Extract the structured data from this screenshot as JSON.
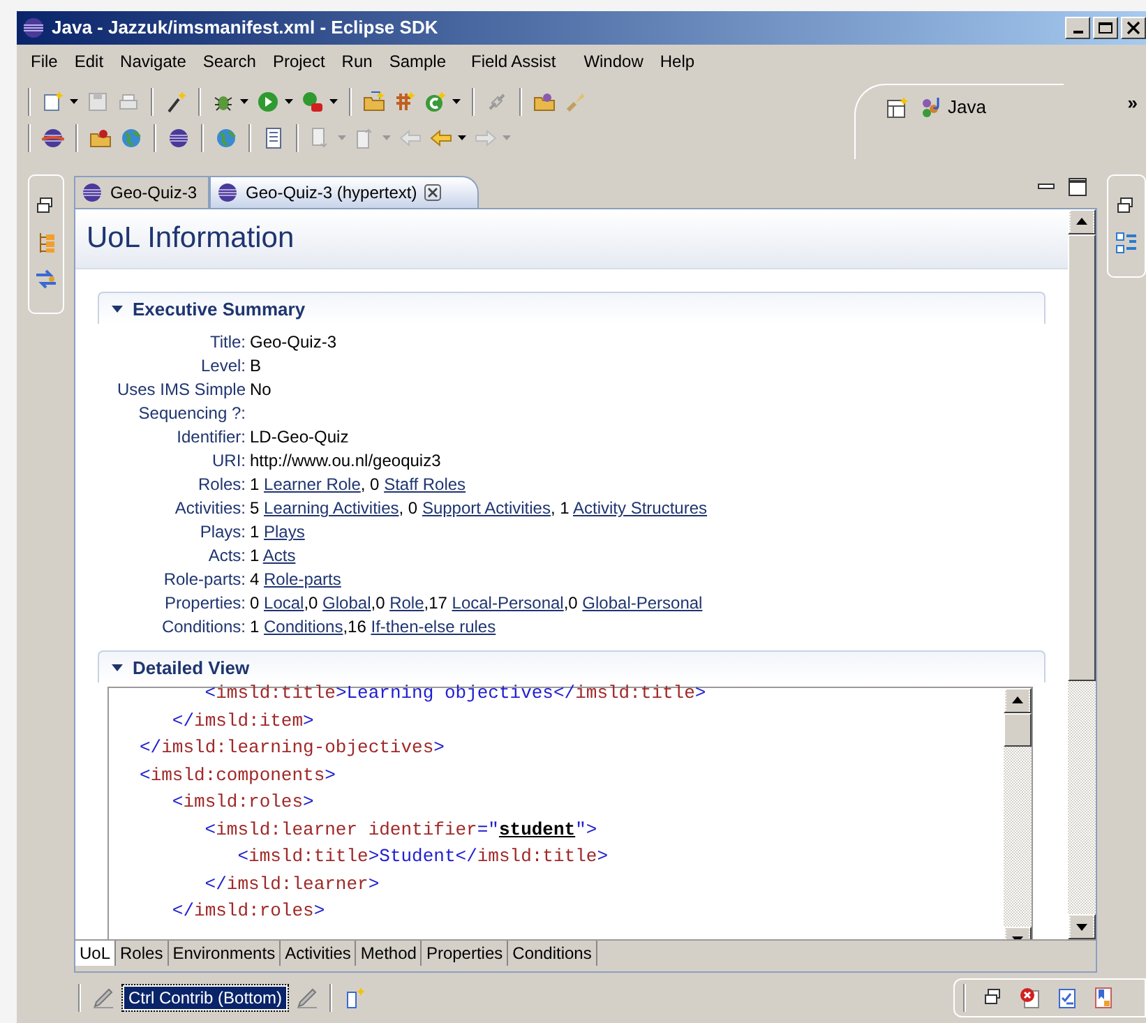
{
  "window": {
    "title": "Java - Jazzuk/imsmanifest.xml - Eclipse SDK"
  },
  "menu": [
    "File",
    "Edit",
    "Navigate",
    "Search",
    "Project",
    "Run",
    "Sample",
    "Field Assist",
    "Window",
    "Help"
  ],
  "perspective": {
    "label": "Java",
    "more": "»"
  },
  "editor_tabs": [
    {
      "label": "Geo-Quiz-3",
      "selected": false,
      "closable": false
    },
    {
      "label": "Geo-Quiz-3 (hypertext)",
      "selected": true,
      "closable": true
    }
  ],
  "form": {
    "title": "UoL Information",
    "sections": [
      {
        "kind": "summary",
        "title": "Executive Summary",
        "expanded": true,
        "fields": [
          {
            "label": "Title:",
            "parts": [
              {
                "text": "Geo-Quiz-3"
              }
            ]
          },
          {
            "label": "Level:",
            "parts": [
              {
                "text": "B"
              }
            ]
          },
          {
            "label": "Uses IMS Simple Sequencing ?:",
            "parts": [
              {
                "text": "No"
              }
            ]
          },
          {
            "label": "Identifier:",
            "parts": [
              {
                "text": "LD-Geo-Quiz"
              }
            ]
          },
          {
            "label": "URI:",
            "parts": [
              {
                "text": "http://www.ou.nl/geoquiz3"
              }
            ]
          },
          {
            "label": "Roles:",
            "parts": [
              {
                "text": "1 "
              },
              {
                "text": "Learner Role",
                "link": true
              },
              {
                "text": ", 0 "
              },
              {
                "text": "Staff Roles",
                "link": true
              }
            ]
          },
          {
            "label": "Activities:",
            "parts": [
              {
                "text": "5 "
              },
              {
                "text": "Learning Activities",
                "link": true
              },
              {
                "text": ", 0 "
              },
              {
                "text": "Support Activities",
                "link": true
              },
              {
                "text": ", 1 "
              },
              {
                "text": "Activity Structures",
                "link": true
              }
            ]
          },
          {
            "label": "Plays:",
            "parts": [
              {
                "text": "1 "
              },
              {
                "text": "Plays",
                "link": true
              }
            ]
          },
          {
            "label": "Acts:",
            "parts": [
              {
                "text": "1 "
              },
              {
                "text": "Acts",
                "link": true
              }
            ]
          },
          {
            "label": "Role-parts:",
            "parts": [
              {
                "text": "4 "
              },
              {
                "text": "Role-parts",
                "link": true
              }
            ]
          },
          {
            "label": "Properties:",
            "parts": [
              {
                "text": "0 "
              },
              {
                "text": "Local",
                "link": true
              },
              {
                "text": ",0 "
              },
              {
                "text": "Global",
                "link": true
              },
              {
                "text": ",0 "
              },
              {
                "text": "Role",
                "link": true
              },
              {
                "text": ",17 "
              },
              {
                "text": "Local-Personal",
                "link": true
              },
              {
                "text": ",0 "
              },
              {
                "text": "Global-Personal",
                "link": true
              }
            ]
          },
          {
            "label": "Conditions:",
            "parts": [
              {
                "text": "1 "
              },
              {
                "text": "Conditions",
                "link": true
              },
              {
                "text": ",16 "
              },
              {
                "text": "If-then-else rules",
                "link": true
              }
            ]
          }
        ]
      },
      {
        "kind": "source",
        "title": "Detailed View",
        "expanded": true,
        "lines": [
          [
            {
              "kind": "bracket",
              "text": "      <"
            },
            {
              "kind": "name",
              "text": "imsld:title"
            },
            {
              "kind": "bracket",
              "text": ">"
            },
            {
              "kind": "text",
              "text": "Learning objectives"
            },
            {
              "kind": "bracket",
              "text": "</"
            },
            {
              "kind": "name",
              "text": "imsld:title"
            },
            {
              "kind": "bracket",
              "text": ">"
            }
          ],
          [
            {
              "kind": "bracket",
              "text": "   </"
            },
            {
              "kind": "name",
              "text": "imsld:item"
            },
            {
              "kind": "bracket",
              "text": ">"
            }
          ],
          [
            {
              "kind": "bracket",
              "text": "</"
            },
            {
              "kind": "name",
              "text": "imsld:learning-objectives"
            },
            {
              "kind": "bracket",
              "text": ">"
            }
          ],
          [
            {
              "kind": "bracket",
              "text": "<"
            },
            {
              "kind": "name",
              "text": "imsld:components"
            },
            {
              "kind": "bracket",
              "text": ">"
            }
          ],
          [
            {
              "kind": "bracket",
              "text": "   <"
            },
            {
              "kind": "name",
              "text": "imsld:roles"
            },
            {
              "kind": "bracket",
              "text": ">"
            }
          ],
          [
            {
              "kind": "bracket",
              "text": "      <"
            },
            {
              "kind": "name",
              "text": "imsld:learner"
            },
            {
              "kind": "attr",
              "text": " identifier"
            },
            {
              "kind": "bracket",
              "text": "=\""
            },
            {
              "kind": "value",
              "text": "student"
            },
            {
              "kind": "bracket",
              "text": "\">"
            }
          ],
          [
            {
              "kind": "bracket",
              "text": "         <"
            },
            {
              "kind": "name",
              "text": "imsld:title"
            },
            {
              "kind": "bracket",
              "text": ">"
            },
            {
              "kind": "text",
              "text": "Student"
            },
            {
              "kind": "bracket",
              "text": "</"
            },
            {
              "kind": "name",
              "text": "imsld:title"
            },
            {
              "kind": "bracket",
              "text": ">"
            }
          ],
          [
            {
              "kind": "bracket",
              "text": "      </"
            },
            {
              "kind": "name",
              "text": "imsld:learner"
            },
            {
              "kind": "bracket",
              "text": ">"
            }
          ],
          [
            {
              "kind": "bracket",
              "text": "   </"
            },
            {
              "kind": "name",
              "text": "imsld:roles"
            },
            {
              "kind": "bracket",
              "text": ">"
            }
          ]
        ]
      }
    ]
  },
  "page_tabs": [
    {
      "label": "UoL",
      "selected": true
    },
    {
      "label": "Roles",
      "selected": false
    },
    {
      "label": "Environments",
      "selected": false
    },
    {
      "label": "Activities",
      "selected": false
    },
    {
      "label": "Method",
      "selected": false
    },
    {
      "label": "Properties",
      "selected": false
    },
    {
      "label": "Conditions",
      "selected": false
    }
  ],
  "status_bar": {
    "contribution": "Ctrl Contrib (Bottom)"
  }
}
